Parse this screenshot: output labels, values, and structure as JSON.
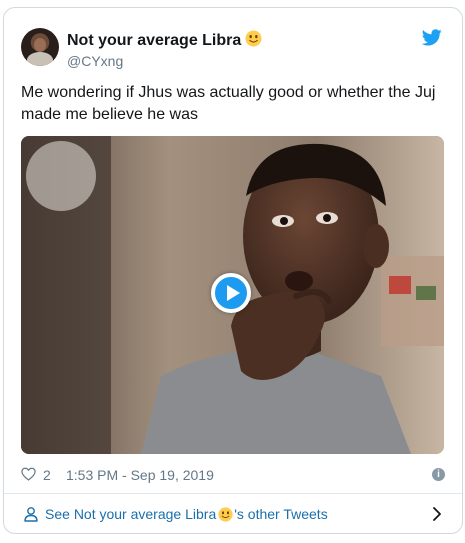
{
  "tweet": {
    "display_name": "Not your average Libra",
    "handle": "@CYxng",
    "text": "Me wondering if Jhus was actually good or whether the Juj made me believe he was",
    "like_count": "2",
    "timestamp": "1:53 PM - Sep 19, 2019",
    "footer": {
      "prefix": "See ",
      "name": "Not your average Libra",
      "suffix": "'s other Tweets"
    }
  },
  "icons": {
    "brand": "twitter-bird-icon",
    "like": "heart-icon",
    "info": "info-icon",
    "person": "person-icon",
    "chevron": "chevron-right-icon",
    "play": "play-icon"
  },
  "colors": {
    "brand_blue": "#1da1f2",
    "link_blue": "#1b6fab",
    "muted": "#657786"
  }
}
